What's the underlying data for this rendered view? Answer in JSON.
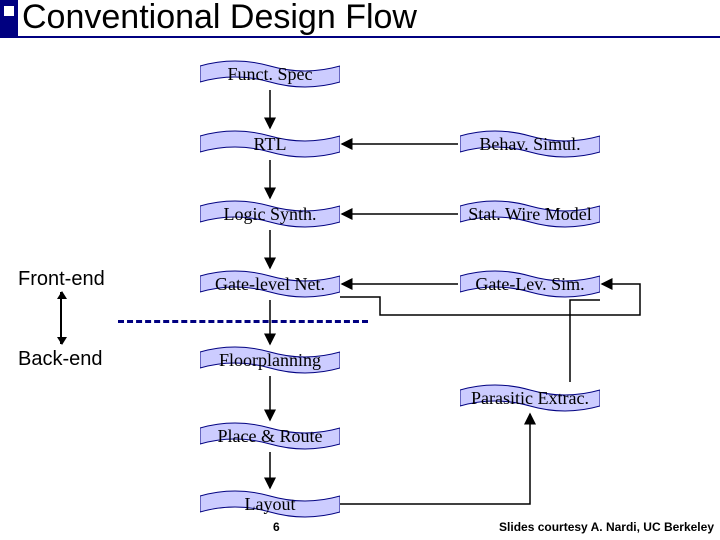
{
  "title": "Conventional Design Flow",
  "side_labels": {
    "front": "Front-end",
    "back": "Back-end"
  },
  "left_col": {
    "spec": "Funct. Spec",
    "rtl": "RTL",
    "synth": "Logic Synth.",
    "gate": "Gate-level Net.",
    "floor": "Floorplanning",
    "pnr": "Place & Route",
    "layout": "Layout"
  },
  "right_col": {
    "behav": "Behav. Simul.",
    "stat": "Stat. Wire Model",
    "glsim": "Gate-Lev. Sim.",
    "parex": "Parasitic Extrac."
  },
  "slide_number": "6",
  "credit": "Slides courtesy A. Nardi, UC Berkeley"
}
